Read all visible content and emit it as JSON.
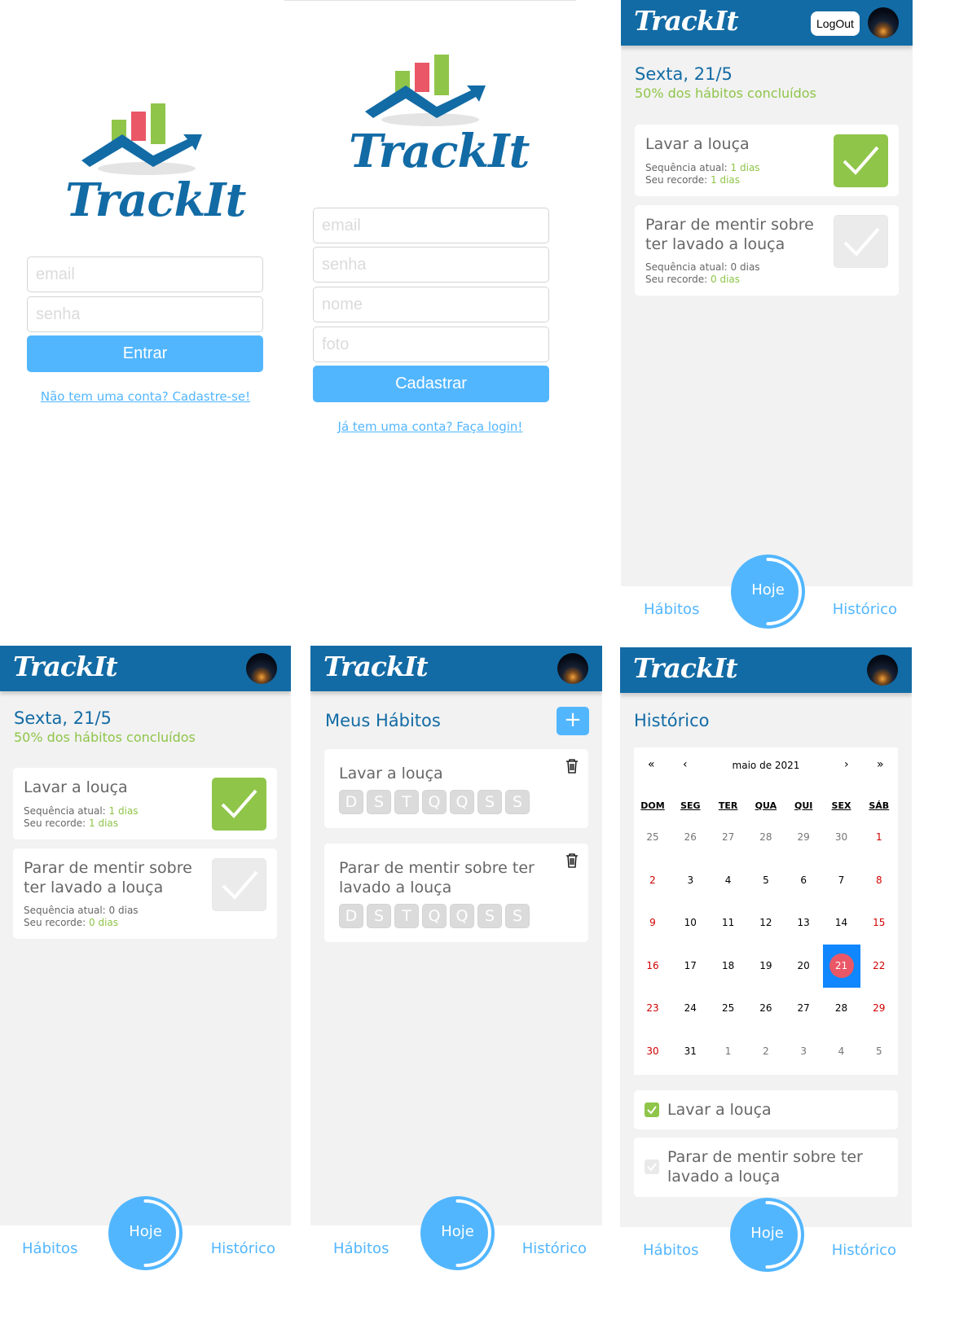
{
  "brand": "TrackIt",
  "colors": {
    "primary": "#126ba5",
    "accent": "#52b6ff",
    "success": "#8fc549",
    "weekend": "#d10000",
    "today_dot": "#ea5766"
  },
  "login": {
    "email_placeholder": "email",
    "password_placeholder": "senha",
    "submit_label": "Entrar",
    "signup_link": "Não tem uma conta? Cadastre-se!"
  },
  "signup": {
    "email_placeholder": "email",
    "password_placeholder": "senha",
    "name_placeholder": "nome",
    "photo_placeholder": "foto",
    "submit_label": "Cadastrar",
    "login_link": "Já tem uma conta? Faça login!"
  },
  "header": {
    "logout_label": "LogOut",
    "avatar_icon": "night-sky-avatar"
  },
  "today": {
    "date_title": "Sexta, 21/5",
    "progress_text": "50% dos hábitos concluídos",
    "progress_fraction": 0.5,
    "habits": [
      {
        "name": "Lavar a louça",
        "streak_label": "Sequência atual:",
        "streak_value": "1 dias",
        "record_label": "Seu recorde:",
        "record_value": "1 dias",
        "done": true
      },
      {
        "name": "Parar de mentir sobre ter lavado a louça",
        "streak_label": "Sequência atual:",
        "streak_value": "0 dias",
        "record_label": "Seu recorde:",
        "record_value": "0 dias",
        "done": false
      }
    ]
  },
  "habits_page": {
    "title": "Meus Hábitos",
    "add_label": "+",
    "weekdays": [
      "D",
      "S",
      "T",
      "Q",
      "Q",
      "S",
      "S"
    ],
    "habits": [
      {
        "name": "Lavar a louça"
      },
      {
        "name": "Parar de mentir sobre ter lavado a louça"
      }
    ]
  },
  "history_page": {
    "title": "Histórico",
    "calendar": {
      "nav_prev_year": "«",
      "nav_prev_month": "‹",
      "month_label": "maio de 2021",
      "nav_next_month": "›",
      "nav_next_year": "»",
      "weekdays": [
        "DOM",
        "SEG",
        "TER",
        "QUA",
        "QUI",
        "SEX",
        "SÁB"
      ],
      "weeks": [
        [
          "25",
          "26",
          "27",
          "28",
          "29",
          "30",
          "1"
        ],
        [
          "2",
          "3",
          "4",
          "5",
          "6",
          "7",
          "8"
        ],
        [
          "9",
          "10",
          "11",
          "12",
          "13",
          "14",
          "15"
        ],
        [
          "16",
          "17",
          "18",
          "19",
          "20",
          "21",
          "22"
        ],
        [
          "23",
          "24",
          "25",
          "26",
          "27",
          "28",
          "29"
        ],
        [
          "30",
          "31",
          "1",
          "2",
          "3",
          "4",
          "5"
        ]
      ],
      "selected_day": "21"
    },
    "items": [
      {
        "name": "Lavar a louça",
        "done": true
      },
      {
        "name": "Parar de mentir sobre ter lavado a louça",
        "done": false
      }
    ]
  },
  "nav": {
    "habits_label": "Hábitos",
    "today_label": "Hoje",
    "history_label": "Histórico"
  }
}
